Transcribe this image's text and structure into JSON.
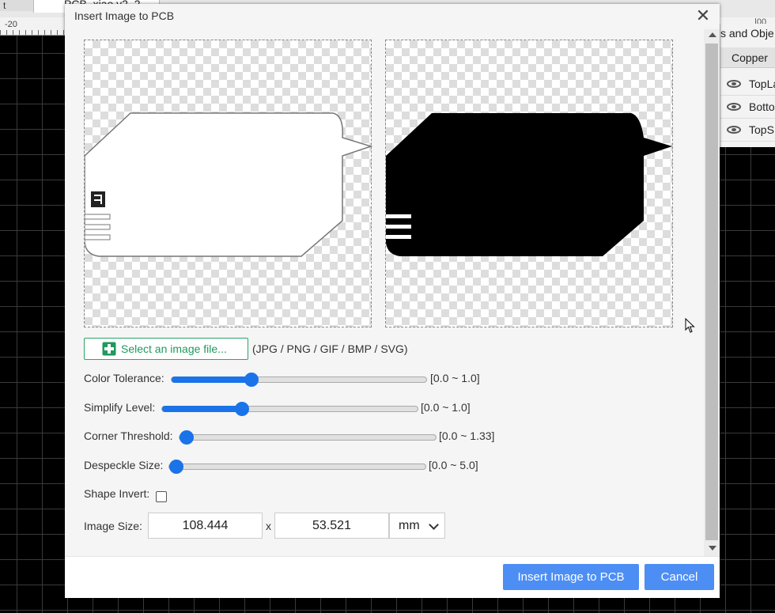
{
  "app": {
    "left_tab_label": "t",
    "doc_tab_label": "PCB_xiao v2_2",
    "ruler_label": "-20",
    "ruler_right_label": "|00"
  },
  "layers_panel": {
    "title": "s and Obje",
    "header": "Copper",
    "items": [
      {
        "label": "TopLa"
      },
      {
        "label": "Botto"
      },
      {
        "label": "TopS"
      }
    ]
  },
  "dialog": {
    "title": "Insert Image to PCB",
    "close_symbol": "✕",
    "select_file_label": "Select an image file...",
    "formats_text": "(JPG / PNG / GIF / BMP / SVG)",
    "params": {
      "color_tolerance": {
        "label": "Color Tolerance:",
        "range": "[0.0 ~ 1.0]",
        "value": 0.3
      },
      "simplify_level": {
        "label": "Simplify Level:",
        "range": "[0.0 ~ 1.0]",
        "value": 0.3
      },
      "corner_threshold": {
        "label": "Corner Threshold:",
        "range": "[0.0 ~ 1.33]",
        "value": 0.0
      },
      "despeckle_size": {
        "label": "Despeckle Size:",
        "range": "[0.0 ~ 5.0]",
        "value": 0.0
      }
    },
    "shape_invert": {
      "label": "Shape Invert:",
      "checked": false
    },
    "image_size": {
      "label": "Image Size:",
      "width": "108.444",
      "separator": "x",
      "height": "53.521",
      "unit": "mm"
    },
    "buttons": {
      "insert": "Insert Image to PCB",
      "cancel": "Cancel"
    }
  },
  "colors": {
    "accent": "#1a73e8",
    "button": "#4d8ef5",
    "file_button": "#1f9a5c"
  }
}
